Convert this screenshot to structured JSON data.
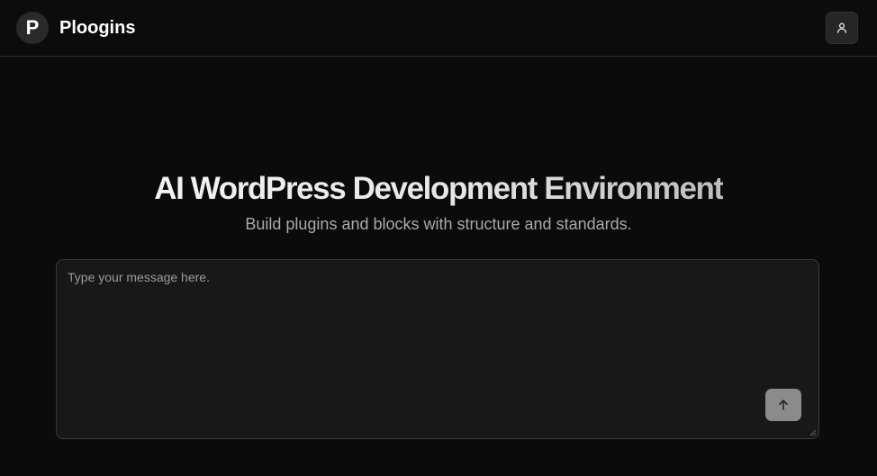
{
  "header": {
    "logo_letter": "P",
    "brand_name": "Ploogins",
    "user_icon": "user-icon"
  },
  "hero": {
    "title": "AI WordPress Development Environment",
    "subtitle": "Build plugins and blocks with structure and standards."
  },
  "composer": {
    "value": "",
    "placeholder": "Type your message here.",
    "send_icon": "arrow-up-icon"
  },
  "colors": {
    "background": "#0b0b0b",
    "composer_background": "#181818",
    "send_button": "#8b8b8b",
    "border": "#2e2e2e"
  }
}
